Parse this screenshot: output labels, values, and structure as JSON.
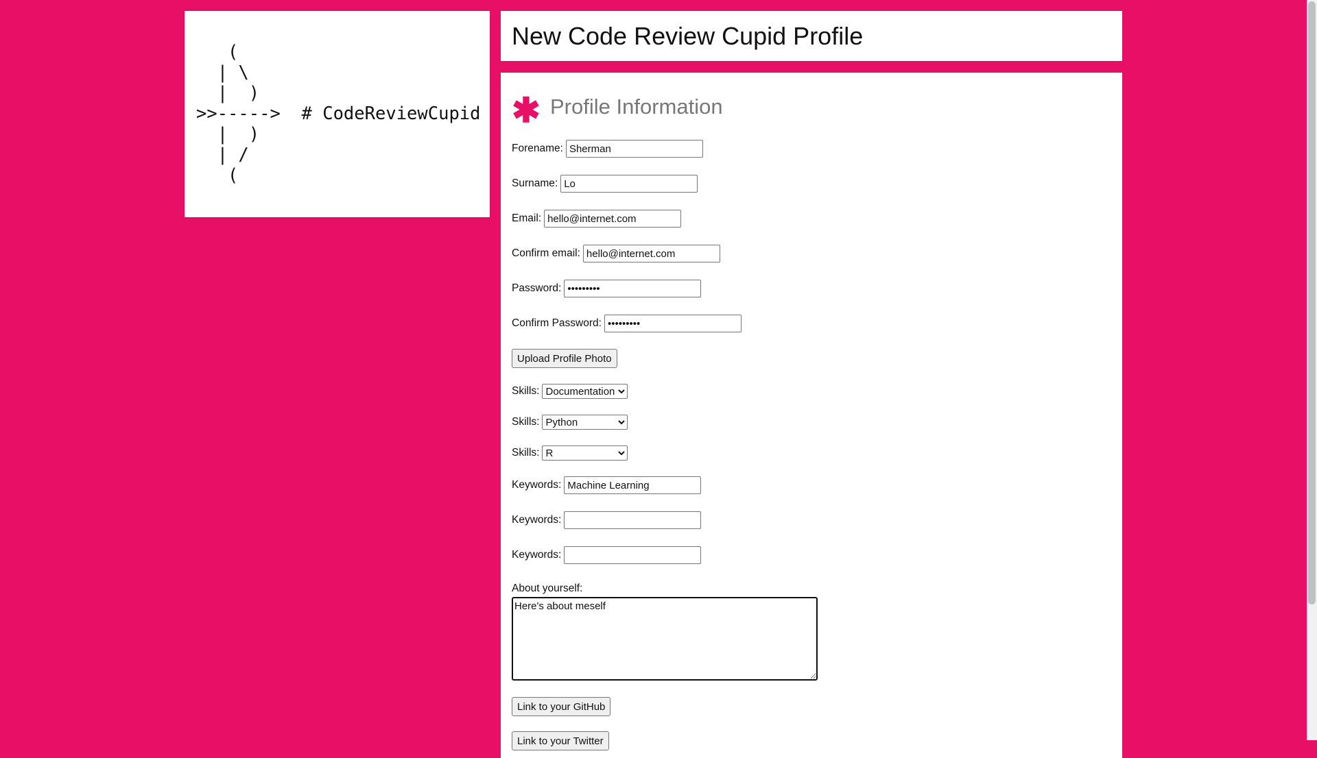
{
  "logo": {
    "ascii_art": "   (\n  | \\\n  |  )\n>>----->  # CodeReviewCupid\n  |  )\n  | /\n   ("
  },
  "header": {
    "title": "New Code Review Cupid Profile"
  },
  "section": {
    "asterisk": "✱",
    "title": "Profile Information"
  },
  "form": {
    "forename": {
      "label": "Forename:",
      "value": "Sherman"
    },
    "surname": {
      "label": "Surname:",
      "value": "Lo"
    },
    "email": {
      "label": "Email:",
      "value": "hello@internet.com"
    },
    "confirm_email": {
      "label": "Confirm email:",
      "value": "hello@internet.com"
    },
    "password": {
      "label": "Password:",
      "value": "password1"
    },
    "confirm_password": {
      "label": "Confirm Password:",
      "value": "password1"
    },
    "upload_photo_label": "Upload Profile Photo",
    "skills": [
      {
        "label": "Skills:",
        "value": "Documentation"
      },
      {
        "label": "Skills:",
        "value": "Python"
      },
      {
        "label": "Skills:",
        "value": "R"
      }
    ],
    "keywords": [
      {
        "label": "Keywords:",
        "value": "Machine Learning"
      },
      {
        "label": "Keywords:",
        "value": ""
      },
      {
        "label": "Keywords:",
        "value": ""
      }
    ],
    "about": {
      "label": "About yourself:",
      "value": "Here's about meself"
    },
    "github_label": "Link to your GitHub",
    "twitter_label": "Link to your Twitter"
  },
  "colors": {
    "background": "#e80f66",
    "accent": "#e80f66",
    "card": "#ffffff",
    "section_title": "#777777"
  }
}
